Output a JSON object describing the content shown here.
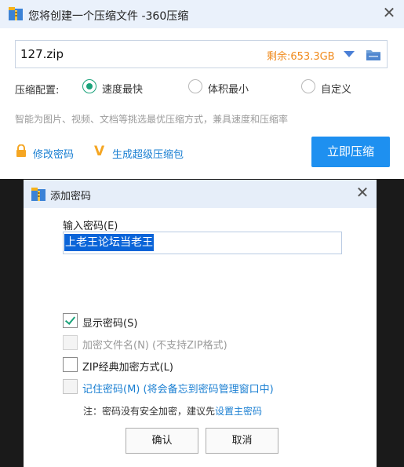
{
  "compress_window": {
    "title": "您将创建一个压缩文件 -360压缩",
    "close_symbol": "✕",
    "file_name": "127.zip",
    "free_space": "剩余:653.3GB",
    "config_label": "压缩配置:",
    "options": [
      "速度最快",
      "体积最小",
      "自定义"
    ],
    "selected_option": "速度最快",
    "hint": "智能为图片、视频、文档等挑选最优压缩方式，兼具速度和压缩率",
    "change_password_label": "修改密码",
    "super_pack_label": "生成超级压缩包",
    "compress_button_label": "立即压缩",
    "accent_color": "#1e90f0",
    "warning_color": "#f08a1c"
  },
  "password_dialog": {
    "title": "添加密码",
    "close_symbol": "✕",
    "input_label": "输入密码(E)",
    "password_value": "上老王论坛当老王",
    "checkboxes": [
      {
        "label": "显示密码(S)",
        "checked": true,
        "enabled": true
      },
      {
        "label": "加密文件名(N) (不支持ZIP格式)",
        "checked": false,
        "enabled": false
      },
      {
        "label": "ZIP经典加密方式(L)",
        "checked": false,
        "enabled": true
      },
      {
        "label": "记住密码(M) (将会备忘到密码管理窗口中)",
        "checked": false,
        "enabled": true
      }
    ],
    "note_text": "注：密码没有安全加密，建议先",
    "note_link": "设置主密码",
    "ok_label": "确认",
    "cancel_label": "取消"
  }
}
